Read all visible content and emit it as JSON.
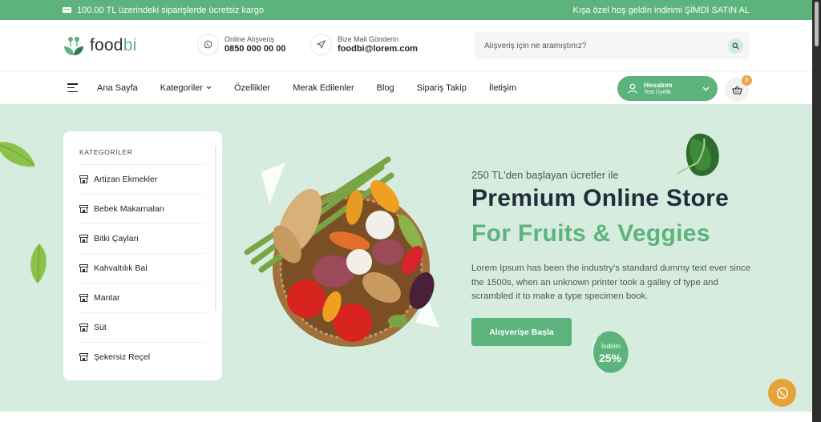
{
  "topbar": {
    "shipping_text": "100.00 TL üzerindeki siparişlerde ücretsiz kargo",
    "promo_text": "Kışa özel hoş geldin indirimi ŞİMDİ SATIN AL"
  },
  "logo": {
    "part1": "food",
    "part2": "bi"
  },
  "contact": {
    "phone_label": "Online Alışveriş",
    "phone_value": "0850 000 00 00",
    "mail_label": "Bize Mail Gönderin",
    "mail_value": "foodbi@lorem.com"
  },
  "search": {
    "placeholder": "Alışveriş için ne aramıştınız?"
  },
  "nav": {
    "items": [
      "Ana Sayfa",
      "Kategoriler",
      "Özellikler",
      "Merak Edilenler",
      "Blog",
      "Sipariş Takip",
      "İletişim"
    ]
  },
  "account": {
    "title": "Hesabım",
    "subtitle": "Test Üyelik"
  },
  "cart": {
    "count": "0"
  },
  "categories": {
    "title": "KATEGORİLER",
    "items": [
      "Artizan Ekmekler",
      "Bebek Makarnaları",
      "Bitki Çayları",
      "Kahvaltılık Bal",
      "Mantar",
      "Süt",
      "Şekersiz Reçel"
    ]
  },
  "hero": {
    "subtitle": "250 TL'den başlayan ücretler ile",
    "title": "Premium Online Store",
    "title_accent": "For Fruits & Veggies",
    "description": "Lorem Ipsum has been the industry's standard dummy text ever since the 1500s, when an unknown printer took a galley of type and scrambled it to make a type specimen book.",
    "cta": "Alışverişe Başla",
    "discount_label": "İndirim",
    "discount_value": "25%"
  },
  "colors": {
    "brand": "#5cb47c",
    "hero_bg": "#d5ecdf",
    "dark": "#1f2d3a",
    "orange": "#e8a23a"
  },
  "icons": [
    "truck-icon",
    "whatsapp-icon",
    "send-icon",
    "search-icon",
    "menu-icon",
    "chevron-down-icon",
    "user-icon",
    "basket-icon",
    "store-icon"
  ]
}
